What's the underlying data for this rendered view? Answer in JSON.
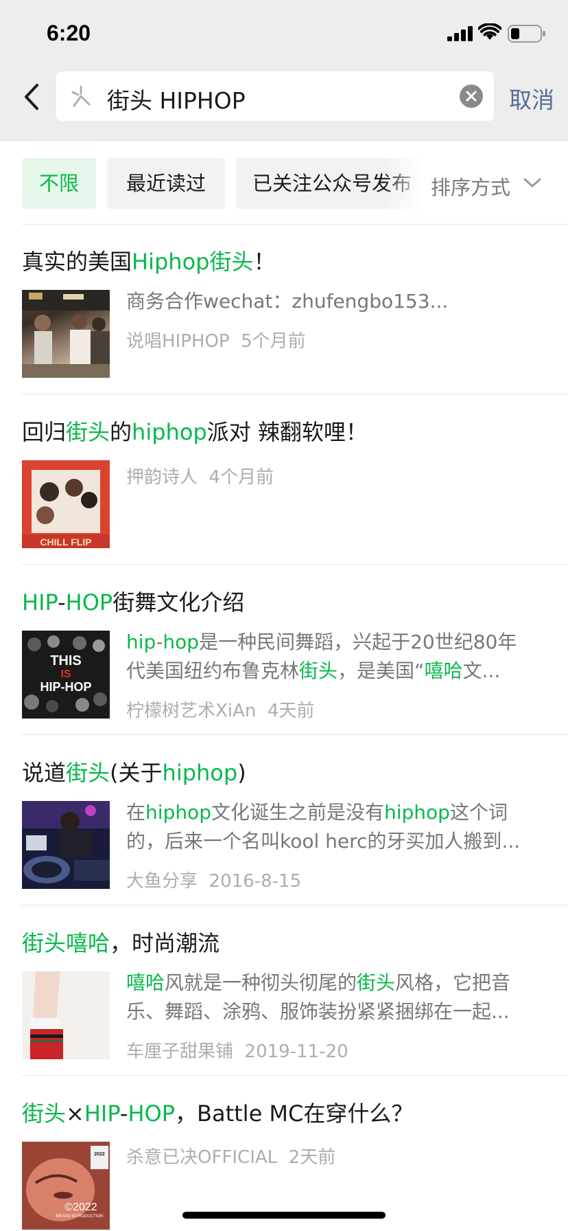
{
  "status_bar": {
    "time": "6:20"
  },
  "search": {
    "query": "街头 HIPHOP",
    "cancel_label": "取消"
  },
  "filters": {
    "chips": [
      "不限",
      "最近读过",
      "已关注公众号发布"
    ],
    "sort_label": "排序方式"
  },
  "results": [
    {
      "title": [
        {
          "t": "真实的美国",
          "h": false
        },
        {
          "t": "Hiphop街头",
          "h": true
        },
        {
          "t": "！",
          "h": false
        }
      ],
      "desc": [
        [
          {
            "t": "商务合作wechat：zhufengbo153...",
            "h": false
          }
        ]
      ],
      "source": "说唱HIPHOP",
      "time": "5个月前"
    },
    {
      "title": [
        {
          "t": "回归",
          "h": false
        },
        {
          "t": "街头",
          "h": true
        },
        {
          "t": "的",
          "h": false
        },
        {
          "t": "hiphop",
          "h": true
        },
        {
          "t": "派对 辣翻软哩！",
          "h": false
        }
      ],
      "desc": [],
      "source": "押韵诗人",
      "time": "4个月前",
      "thumb_text": "CHILL FLIP"
    },
    {
      "title": [
        {
          "t": "HIP",
          "h": true
        },
        {
          "t": "-",
          "h": false
        },
        {
          "t": "HOP",
          "h": true
        },
        {
          "t": "街舞文化介绍",
          "h": false
        }
      ],
      "desc": [
        [
          {
            "t": "hip",
            "h": true
          },
          {
            "t": "-",
            "h": false
          },
          {
            "t": "hop",
            "h": true
          },
          {
            "t": "是一种民间舞蹈，兴起于20世纪80年",
            "h": false
          }
        ],
        [
          {
            "t": "代美国纽约布鲁克林",
            "h": false
          },
          {
            "t": "街头",
            "h": true
          },
          {
            "t": "，是美国“",
            "h": false
          },
          {
            "t": "嘻哈",
            "h": true
          },
          {
            "t": "文...",
            "h": false
          }
        ]
      ],
      "source": "柠檬树艺术XiAn",
      "time": "4天前",
      "thumb_text": [
        "THIS",
        "IS",
        "HIP-HOP"
      ]
    },
    {
      "title": [
        {
          "t": "说道",
          "h": false
        },
        {
          "t": "街头",
          "h": true
        },
        {
          "t": "(关于",
          "h": false
        },
        {
          "t": "hiphop",
          "h": true
        },
        {
          "t": ")",
          "h": false
        }
      ],
      "desc": [
        [
          {
            "t": "在",
            "h": false
          },
          {
            "t": "hiphop",
            "h": true
          },
          {
            "t": "文化诞生之前是没有",
            "h": false
          },
          {
            "t": "hiphop",
            "h": true
          },
          {
            "t": "这个词",
            "h": false
          }
        ],
        [
          {
            "t": "的，后来一个名叫kool herc的牙买加人搬到...",
            "h": false
          }
        ]
      ],
      "source": "大鱼分享",
      "time": "2016-8-15"
    },
    {
      "title": [
        {
          "t": "街头嘻哈",
          "h": true
        },
        {
          "t": "，时尚潮流",
          "h": false
        }
      ],
      "desc": [
        [
          {
            "t": "嘻哈",
            "h": true
          },
          {
            "t": "风就是一种彻头彻尾的",
            "h": false
          },
          {
            "t": "街头",
            "h": true
          },
          {
            "t": "风格，它把音",
            "h": false
          }
        ],
        [
          {
            "t": "乐、舞蹈、涂鸦、服饰装扮紧紧捆绑在一起...",
            "h": false
          }
        ]
      ],
      "source": "车厘子甜果铺",
      "time": "2019-11-20"
    },
    {
      "title": [
        {
          "t": "街头",
          "h": true
        },
        {
          "t": "×",
          "h": false
        },
        {
          "t": "HIP",
          "h": true
        },
        {
          "t": "-",
          "h": false
        },
        {
          "t": "HOP",
          "h": true
        },
        {
          "t": "，Battle MC在穿什么？",
          "h": false
        }
      ],
      "desc": [],
      "source": "杀意已决OFFICIAL",
      "time": "2天前",
      "thumb_text": [
        "2022",
        "©2022",
        "BRAND INTRODUCTION"
      ]
    }
  ],
  "colors": {
    "highlight": "#07b84a",
    "link": "#576b95",
    "meta": "#adadad"
  }
}
